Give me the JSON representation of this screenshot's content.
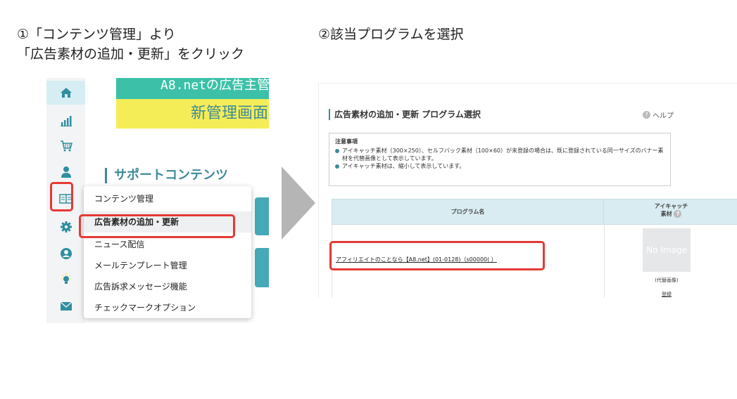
{
  "steps": {
    "step1_line1": "①「コンテンツ管理」より",
    "step1_line2": "「広告素材の追加・更新」をクリック",
    "step2": "②該当プログラムを選択"
  },
  "left_panel": {
    "sidebar_icons": [
      "home-icon",
      "chart-icon",
      "cart-icon",
      "user-icon",
      "book-icon",
      "gear-icon",
      "account-icon",
      "lightbulb-icon",
      "mail-icon"
    ],
    "banner_line1": "A8.netの広告主管",
    "banner_line2": "新管理画面",
    "support_heading": "サポートコンテンツ",
    "menu": {
      "items": [
        "コンテンツ管理",
        "広告素材の追加・更新",
        "ニュース配信",
        "メールテンプレート管理",
        "広告訴求メッセージ機能",
        "チェックマークオプション"
      ]
    }
  },
  "right_panel": {
    "title": "広告素材の追加・更新 プログラム選択",
    "help_label": "ヘルプ",
    "help_mark": "?",
    "notice": {
      "heading": "注意事項",
      "bullets": [
        "アイキャッチ素材（300×250）、セルフバック素材（100×60）が未登録の場合は、既に登録されている同一サイズのバナー素材を代替画像として表示しています。",
        "アイキャッチ素材は、縮小して表示しています。"
      ]
    },
    "table": {
      "col1_header": "プログラム名",
      "col2_header_line1": "アイキャッチ",
      "col2_header_line2": "素材",
      "row": {
        "program_name": "アフィリエイトのことなら【A8.net】(01-0128)（s00000(              ）",
        "image_placeholder": "No Image",
        "image_note": "(代替画像)",
        "register_link": "登録"
      }
    }
  },
  "colors": {
    "teal": "#3e8a9a",
    "highlight_red": "#e53935",
    "banner_green": "#3cc1a8",
    "banner_yellow": "#f4ed57",
    "table_header": "#d9ecf1"
  }
}
